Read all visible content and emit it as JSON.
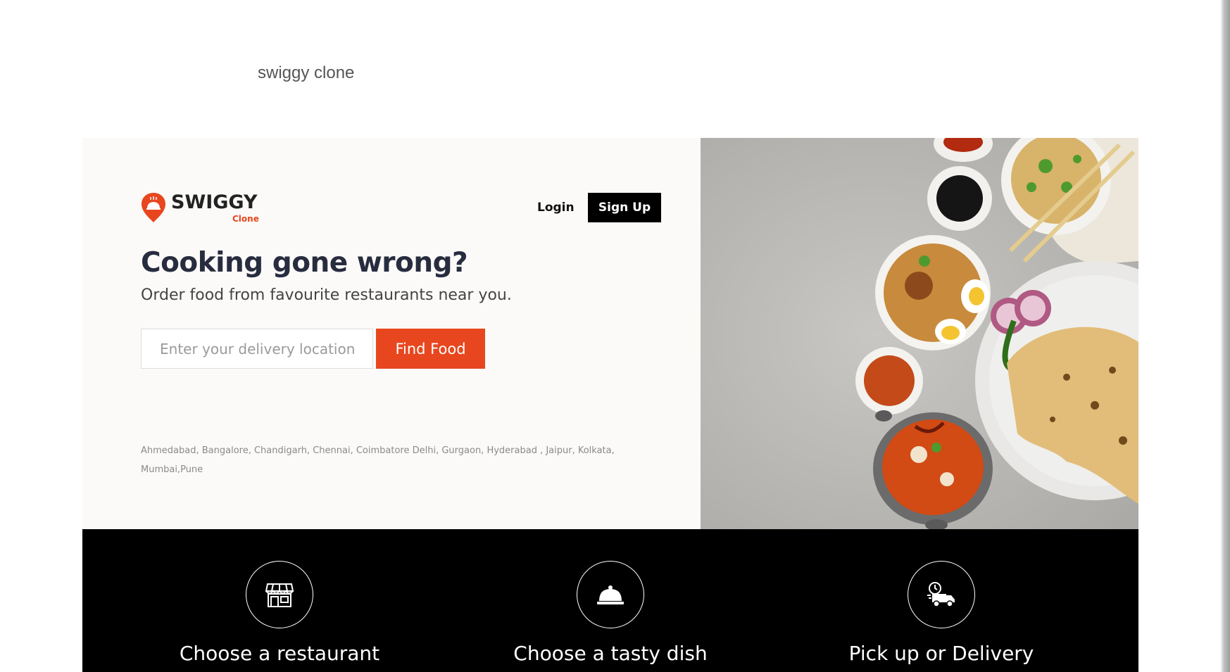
{
  "page": {
    "heading": "swiggy clone"
  },
  "header": {
    "logo_text": "SWIGGY",
    "logo_subtext": "Clone",
    "login_label": "Login",
    "signup_label": "Sign Up"
  },
  "hero": {
    "title": "Cooking gone wrong?",
    "subtitle": "Order food from favourite restaurants near you.",
    "location_placeholder": "Enter your delivery location",
    "location_value": "",
    "find_food_label": "Find Food",
    "cities_text": "Ahmedabad,  Bangalore,  Chandigarh,  Chennai,  Coimbatore Delhi,  Gurgaon,  Hyderabad ,  Jaipur,  Kolkata, Mumbai,Pune",
    "image": "food-platter-photo"
  },
  "steps": [
    {
      "icon": "restaurant-icon",
      "label": "Choose a restaurant"
    },
    {
      "icon": "dish-cloche-icon",
      "label": "Choose a tasty dish"
    },
    {
      "icon": "delivery-truck-icon",
      "label": "Pick up or Delivery"
    }
  ],
  "colors": {
    "accent": "#e8461e",
    "hero_bg": "#fbfaf8",
    "steps_bg": "#000000",
    "text_dark": "#282c3f"
  }
}
